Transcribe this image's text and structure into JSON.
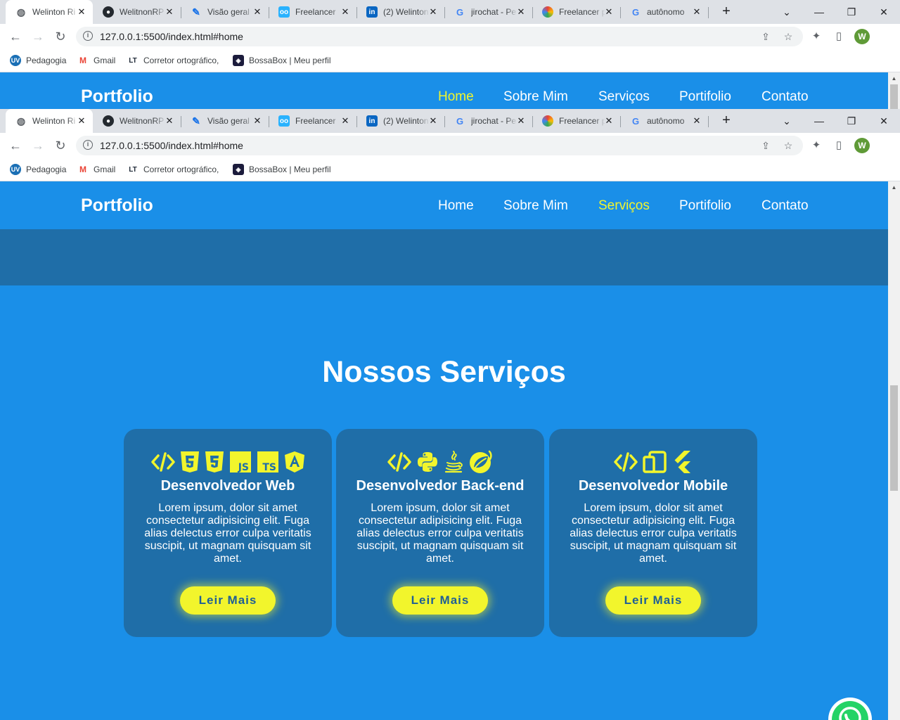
{
  "browser": {
    "tabs": [
      {
        "label": "Welinton Ri",
        "icon": "globe-icon",
        "active": true
      },
      {
        "label": "WelitnonRP",
        "icon": "github-icon",
        "active": false
      },
      {
        "label": "Visão geral",
        "icon": "quill-icon",
        "active": false
      },
      {
        "label": "Freelancer",
        "icon": "freelancer-icon",
        "active": false
      },
      {
        "label": "(2) Welinton",
        "icon": "linkedin-icon",
        "active": false
      },
      {
        "label": "jirochat - Pe",
        "icon": "google-icon",
        "active": false
      },
      {
        "label": "Freelancer p",
        "icon": "chrome-color-icon",
        "active": false
      },
      {
        "label": "autônomo",
        "icon": "google-icon",
        "active": false
      }
    ],
    "url": "127.0.0.1:5500/index.html#home",
    "profile_initial": "W",
    "bookmarks": [
      {
        "label": "Pedagogia",
        "icon": "uv-icon"
      },
      {
        "label": "Gmail",
        "icon": "gmail-icon"
      },
      {
        "label": "Corretor ortográfico,",
        "icon": "languagetool-icon"
      },
      {
        "label": "BossaBox | Meu perfil",
        "icon": "bossabox-icon"
      }
    ]
  },
  "site": {
    "logo": "Portfolio",
    "nav": [
      "Home",
      "Sobre Mim",
      "Serviços",
      "Portifolio",
      "Contato"
    ],
    "active_nav_top": "Home",
    "active_nav_bottom": "Serviços"
  },
  "services": {
    "title": "Nossos Serviços",
    "cards": [
      {
        "title": "Desenvolvedor Web",
        "icons": [
          "code-icon",
          "html5-icon",
          "css3-icon",
          "javascript-icon",
          "typescript-icon",
          "angular-icon"
        ],
        "text": "Lorem ipsum, dolor sit amet consectetur adipisicing elit. Fuga alias delectus error culpa veritatis suscipit, ut magnam quisquam sit amet.",
        "button": "Leir Mais"
      },
      {
        "title": "Desenvolvedor Back-end",
        "icons": [
          "code-icon",
          "python-icon",
          "java-icon",
          "spring-icon"
        ],
        "text": "Lorem ipsum, dolor sit amet consectetur adipisicing elit. Fuga alias delectus error culpa veritatis suscipit, ut magnam quisquam sit amet.",
        "button": "Leir Mais"
      },
      {
        "title": "Desenvolvedor Mobile",
        "icons": [
          "code-icon",
          "mobile-devices-icon",
          "flutter-icon"
        ],
        "text": "Lorem ipsum, dolor sit amet consectetur adipisicing elit. Fuga alias delectus error culpa veritatis suscipit, ut magnam quisquam sit amet.",
        "button": "Leir Mais"
      }
    ]
  },
  "colors": {
    "page_bg": "#1a8fe8",
    "card_bg": "#1f6ea8",
    "accent": "#f2f52c"
  }
}
